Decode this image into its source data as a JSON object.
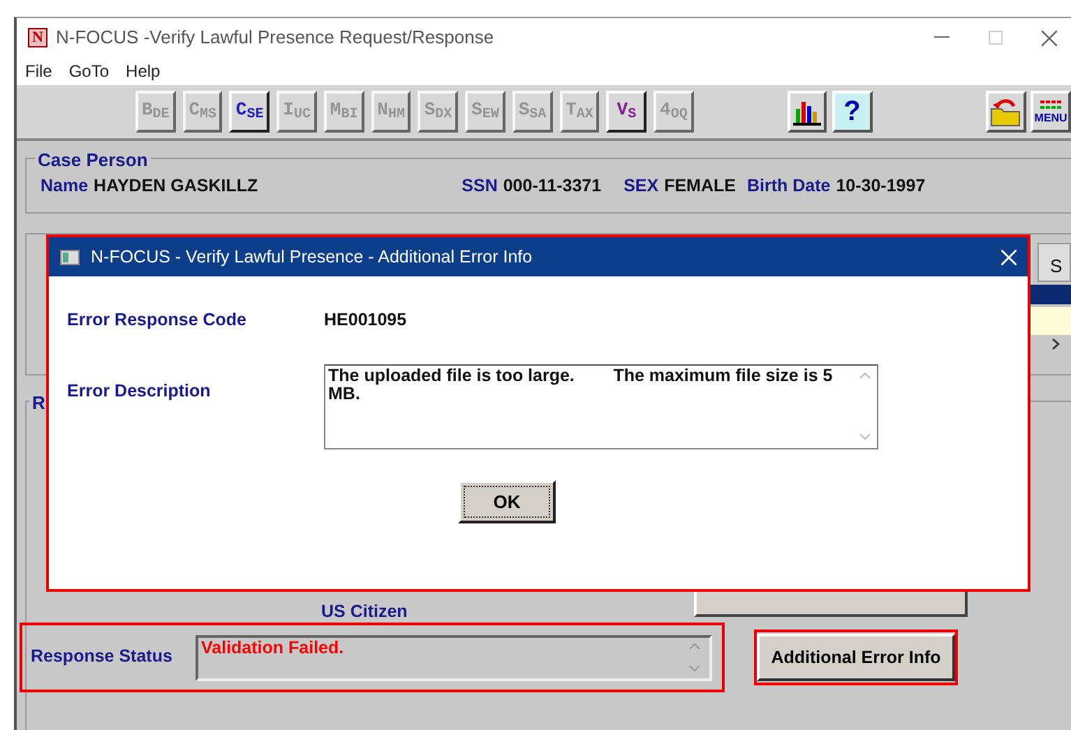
{
  "window": {
    "title": "N-FOCUS -Verify Lawful Presence Request/Response",
    "icon_letter": "N",
    "maximize_disabled": true
  },
  "menu": [
    "File",
    "GoTo",
    "Help"
  ],
  "toolbar": {
    "modules": [
      {
        "letter": "B",
        "sub": "DE",
        "disabled": true,
        "color": "#8a8a8a"
      },
      {
        "letter": "C",
        "sub": "MS",
        "disabled": true,
        "color": "#8a8a8a"
      },
      {
        "letter": "C",
        "sub": "SE",
        "disabled": false,
        "color": "#1c1cc8"
      },
      {
        "letter": "I",
        "sub": "UC",
        "disabled": true,
        "color": "#8a8a8a"
      },
      {
        "letter": "M",
        "sub": "BI",
        "disabled": true,
        "color": "#8a8a8a"
      },
      {
        "letter": "N",
        "sub": "HM",
        "disabled": true,
        "color": "#8a8a8a"
      },
      {
        "letter": "S",
        "sub": "DX",
        "disabled": true,
        "color": "#8a8a8a"
      },
      {
        "letter": "S",
        "sub": "EW",
        "disabled": true,
        "color": "#8a8a8a"
      },
      {
        "letter": "S",
        "sub": "SA",
        "disabled": true,
        "color": "#8a8a8a"
      },
      {
        "letter": "T",
        "sub": "AX",
        "disabled": true,
        "color": "#8a8a8a"
      },
      {
        "letter": "V",
        "sub": "S",
        "disabled": false,
        "color": "#8a1c9a"
      },
      {
        "letter": "4",
        "sub": "OQ",
        "disabled": true,
        "color": "#8a8a8a"
      }
    ],
    "help_label": "?",
    "menu_label": "MENU"
  },
  "case_person": {
    "title": "Case Person",
    "fields": [
      {
        "label": "Name",
        "value": "HAYDEN GASKILLZ"
      },
      {
        "label": "SSN",
        "value": "000-11-3371"
      },
      {
        "label": "SEX",
        "value": "FEMALE"
      },
      {
        "label": "Birth Date",
        "value": "10-30-1997"
      }
    ]
  },
  "request_information": {
    "tab_label": "S"
  },
  "response": {
    "title": "R",
    "citizenship": "US Citizen",
    "status_label": "Response Status",
    "status_value": "Validation Failed.",
    "additional_button": "Additional Error Info"
  },
  "dialog": {
    "title": "N-FOCUS - Verify Lawful Presence - Additional Error Info",
    "fields": [
      {
        "kind": "text",
        "label": "Error Response Code",
        "value": "HE001095"
      },
      {
        "kind": "textarea",
        "label": "Error Description",
        "value": "The uploaded file is too large.        The maximum file size is 5 MB."
      }
    ],
    "ok_button": "OK"
  }
}
